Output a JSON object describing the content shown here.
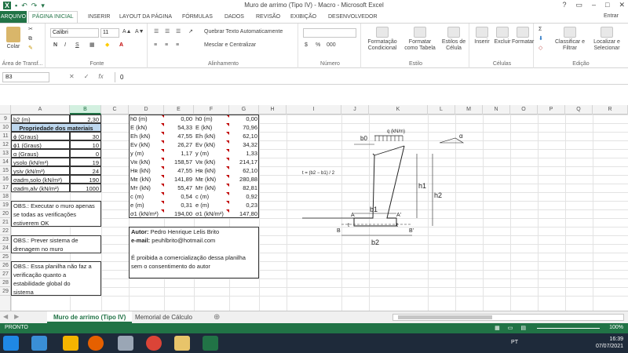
{
  "window": {
    "title": "Muro de arrimo (Tipo IV) - Macro - Microsoft Excel",
    "help": "?",
    "user": "Entrar"
  },
  "tabs": [
    "ARQUIVO",
    "PÁGINA INICIAL",
    "INSERIR",
    "LAYOUT DA PÁGINA",
    "FÓRMULAS",
    "DADOS",
    "REVISÃO",
    "EXIBIÇÃO",
    "DESENVOLVEDOR"
  ],
  "ribbon": {
    "paste": "Colar",
    "clipboard": "Área de Transf...",
    "font_name": "Calibri",
    "font_size": "11",
    "font_group": "Fonte",
    "bold": "N",
    "italic": "I",
    "underline": "S",
    "wrap": "Quebrar Texto Automaticamente",
    "merge": "Mesclar e Centralizar",
    "align_group": "Alinhamento",
    "number_group": "Número",
    "cond_format": "Formatação Condicional",
    "format_table": "Formatar como Tabela",
    "cell_styles": "Estilos de Célula",
    "style_group": "Estilo",
    "insert": "Inserir",
    "delete": "Excluir",
    "format": "Formatar",
    "cells_group": "Células",
    "sort": "Classificar e Filtrar",
    "find": "Localizar e Selecionar",
    "edit_group": "Edição"
  },
  "formula_bar": {
    "name_box": "B3",
    "fx": "fx",
    "value": "0"
  },
  "columns": [
    "A",
    "B",
    "C",
    "D",
    "E",
    "F",
    "G",
    "H",
    "I",
    "J",
    "K",
    "L",
    "M",
    "N",
    "O",
    "P",
    "Q",
    "R"
  ],
  "rows": [
    "9",
    "10",
    "11",
    "12",
    "13",
    "14",
    "15",
    "16",
    "17",
    "18",
    "19",
    "20",
    "21",
    "22",
    "23",
    "24",
    "25",
    "26",
    "27",
    "28",
    "29"
  ],
  "cells": {
    "a9": "b2 (m)",
    "b9": "2,30",
    "a10": "Propriedade dos materiais",
    "a11": "ϕ (Graus)",
    "b11": "30",
    "a12": "ϕ1 (Graus)",
    "b12": "10",
    "a13": "α (Graus)",
    "b13": "0",
    "a14": "γsolo (kN/m³)",
    "b14": "19",
    "a15": "γsiv (kN/m³)",
    "b15": "24",
    "a16": "σadm,solo (kN/m²)",
    "b16": "190",
    "a17": "σadm,alv (kN/m²)",
    "b17": "1000",
    "obs1": [
      "OBS.: Executar o muro apenas",
      "se todas as verificações",
      "estiverem OK"
    ],
    "obs2": [
      "OBS.: Prever sistema de",
      "drenagem no muro"
    ],
    "obs3": [
      "OBS.: Essa planilha não faz a",
      "verificação quanto a",
      "estabilidade global do",
      "sistema"
    ],
    "table": [
      [
        "h0 (m)",
        "0,00",
        "h0 (m)",
        "0,00"
      ],
      [
        "E (kN)",
        "54,33",
        "E (kN)",
        "70,96"
      ],
      [
        "Eh (kN)",
        "47,55",
        "Eh (kN)",
        "62,10"
      ],
      [
        "Ev (kN)",
        "26,27",
        "Ev (kN)",
        "34,32"
      ],
      [
        "y (m)",
        "1,17",
        "y (m)",
        "1,33"
      ],
      [
        "Vʀ (kN)",
        "158,57",
        "Vʀ (kN)",
        "214,17"
      ],
      [
        "Hʀ (kN)",
        "47,55",
        "Hʀ (kN)",
        "62,10"
      ],
      [
        "Mᴇ (kN)",
        "141,89",
        "Mᴇ (kN)",
        "280,88"
      ],
      [
        "Mᴛ (kN)",
        "55,47",
        "Mᴛ (kN)",
        "82,81"
      ],
      [
        "c (m)",
        "0,54",
        "c (m)",
        "0,92"
      ],
      [
        "e (m)",
        "0,31",
        "e (m)",
        "0,23"
      ],
      [
        "σ1 (kN/m²)",
        "194,00",
        "σ1 (kN/m²)",
        "147,80"
      ]
    ],
    "author_label": "Autor:",
    "author": "Pedro Henrique Lelis Brito",
    "email_label": "e-mail:",
    "email": "peuhlbrito@hotmail.com",
    "notice": [
      "É proibida a comercialização dessa planilha",
      "sem o consentimento do autor"
    ]
  },
  "diagram": {
    "load": "q (kN/m)",
    "b0": "b0",
    "alpha": "α",
    "formula": "t = (b2 − b1) / 2",
    "h1": "h1",
    "h2": "h2",
    "b1": "b1",
    "b2": "b2",
    "A": "A",
    "A_prime": "A'",
    "B": "B",
    "B_prime": "B'",
    "t": "t"
  },
  "sheets": [
    "Muro de arrimo (Tipo IV)",
    "Memorial de Cálculo"
  ],
  "status": {
    "ready": "PRONTO",
    "zoom": "100%"
  },
  "taskbar": {
    "lang": "PT",
    "time": "16:39",
    "date": "07/07/2021"
  }
}
